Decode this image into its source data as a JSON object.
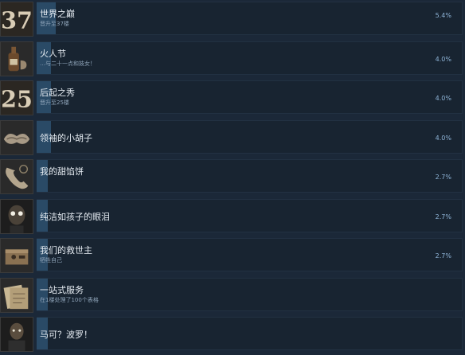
{
  "achievements": [
    {
      "title": "世界之巅",
      "desc": "晋升至37楼",
      "pct": "5.4%",
      "progress": 0.054,
      "icon": "number-37-icon",
      "glyph": "37"
    },
    {
      "title": "火人节",
      "desc": "…与二十一点和妓女！",
      "pct": "4.0%",
      "progress": 0.04,
      "icon": "bottle-icon",
      "glyph": ""
    },
    {
      "title": "后起之秀",
      "desc": "晋升至25楼",
      "pct": "4.0%",
      "progress": 0.04,
      "icon": "number-25-icon",
      "glyph": "25"
    },
    {
      "title": "领袖的小胡子",
      "desc": "",
      "pct": "4.0%",
      "progress": 0.04,
      "icon": "mustache-icon",
      "glyph": ""
    },
    {
      "title": "我的甜馅饼",
      "desc": "",
      "pct": "2.7%",
      "progress": 0.027,
      "icon": "telephone-icon",
      "glyph": ""
    },
    {
      "title": "纯洁如孩子的眼泪",
      "desc": "",
      "pct": "2.7%",
      "progress": 0.027,
      "icon": "face-icon",
      "glyph": ""
    },
    {
      "title": "我们的救世主",
      "desc": "牺牲自己",
      "pct": "2.7%",
      "progress": 0.027,
      "icon": "bomb-box-icon",
      "glyph": ""
    },
    {
      "title": "一站式服务",
      "desc": "在1楼处理了100个表格",
      "pct": "",
      "progress": 0.027,
      "icon": "documents-icon",
      "glyph": ""
    },
    {
      "title": "马可？波罗！",
      "desc": "",
      "pct": "",
      "progress": 0.027,
      "icon": "portrait-icon",
      "glyph": ""
    }
  ],
  "colors": {
    "background": "#1b2838",
    "bar": "#2a4a66",
    "percent": "#8fb5d8"
  }
}
